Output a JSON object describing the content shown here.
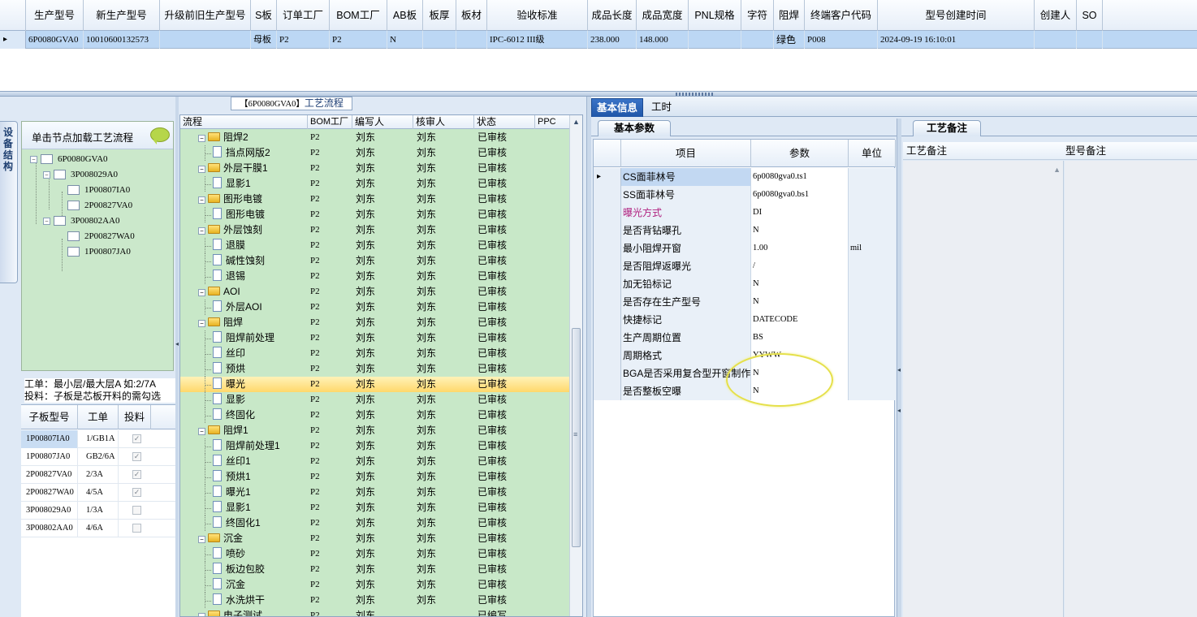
{
  "top_grid": {
    "headers": [
      "生产型号",
      "新生产型号",
      "升级前旧生产型号",
      "S板",
      "订单工厂",
      "BOM工厂",
      "AB板",
      "板厚",
      "板材",
      "验收标准",
      "成品长度",
      "成品宽度",
      "PNL规格",
      "字符",
      "阻焊",
      "终端客户代码",
      "型号创建时间",
      "创建人",
      "SO"
    ],
    "row": [
      "6P0080GVA0",
      "10010600132573",
      "",
      "母板",
      "P2",
      "P2",
      "N",
      "",
      "",
      "IPC-6012 III级",
      "238.000",
      "148.000",
      "",
      "",
      "绿色",
      "P008",
      "2024-09-19 16:10:01",
      "",
      ""
    ]
  },
  "left": {
    "vertical_tab": "设备结构",
    "tree_header": "单击节点加载工艺流程",
    "tree": [
      "6P0080GVA0",
      "3P008029A0",
      "1P00807IA0",
      "2P00827VA0",
      "3P00802AA0",
      "2P00827WA0",
      "1P00807JA0"
    ],
    "info_line1": "工单：最小层/最大层A 如:2/7A",
    "info_line2": "投料：子板是芯板开料的需勾选",
    "sub_headers": [
      "子板型号",
      "工单",
      "投料"
    ],
    "sub_rows": [
      {
        "model": "1P00807IA0",
        "order": "1/GB1A",
        "feed": "checked"
      },
      {
        "model": "1P00807JA0",
        "order": "GB2/6A",
        "feed": "checked"
      },
      {
        "model": "2P00827VA0",
        "order": "2/3A",
        "feed": "checked"
      },
      {
        "model": "2P00827WA0",
        "order": "4/5A",
        "feed": "checked"
      },
      {
        "model": "3P008029A0",
        "order": "1/3A",
        "feed": "unchecked"
      },
      {
        "model": "3P00802AA0",
        "order": "4/6A",
        "feed": "unchecked"
      }
    ]
  },
  "process": {
    "title_prefix": "【6P0080GVA0】",
    "title": "工艺流程",
    "headers": [
      "流程",
      "BOM工厂",
      "编写人",
      "核审人",
      "状态",
      "PPC"
    ],
    "rows": [
      {
        "name": "阻焊2",
        "type": "folder",
        "bom": "P2",
        "writer": "刘东",
        "reviewer": "刘东",
        "status": "已审核"
      },
      {
        "name": "挡点网版2",
        "type": "doc",
        "bom": "P2",
        "writer": "刘东",
        "reviewer": "刘东",
        "status": "已审核"
      },
      {
        "name": "外层干膜1",
        "type": "folder",
        "bom": "P2",
        "writer": "刘东",
        "reviewer": "刘东",
        "status": "已审核"
      },
      {
        "name": "显影1",
        "type": "doc",
        "bom": "P2",
        "writer": "刘东",
        "reviewer": "刘东",
        "status": "已审核"
      },
      {
        "name": "图形电镀",
        "type": "folder",
        "bom": "P2",
        "writer": "刘东",
        "reviewer": "刘东",
        "status": "已审核"
      },
      {
        "name": "图形电镀",
        "type": "doc",
        "bom": "P2",
        "writer": "刘东",
        "reviewer": "刘东",
        "status": "已审核"
      },
      {
        "name": "外层蚀刻",
        "type": "folder",
        "bom": "P2",
        "writer": "刘东",
        "reviewer": "刘东",
        "status": "已审核"
      },
      {
        "name": "退膜",
        "type": "doc",
        "bom": "P2",
        "writer": "刘东",
        "reviewer": "刘东",
        "status": "已审核"
      },
      {
        "name": "碱性蚀刻",
        "type": "doc",
        "bom": "P2",
        "writer": "刘东",
        "reviewer": "刘东",
        "status": "已审核"
      },
      {
        "name": "退锡",
        "type": "doc",
        "bom": "P2",
        "writer": "刘东",
        "reviewer": "刘东",
        "status": "已审核"
      },
      {
        "name": "AOI",
        "type": "folder",
        "bom": "P2",
        "writer": "刘东",
        "reviewer": "刘东",
        "status": "已审核"
      },
      {
        "name": "外层AOI",
        "type": "doc",
        "bom": "P2",
        "writer": "刘东",
        "reviewer": "刘东",
        "status": "已审核"
      },
      {
        "name": "阻焊",
        "type": "folder",
        "bom": "P2",
        "writer": "刘东",
        "reviewer": "刘东",
        "status": "已审核"
      },
      {
        "name": "阻焊前处理",
        "type": "doc",
        "bom": "P2",
        "writer": "刘东",
        "reviewer": "刘东",
        "status": "已审核"
      },
      {
        "name": "丝印",
        "type": "doc",
        "bom": "P2",
        "writer": "刘东",
        "reviewer": "刘东",
        "status": "已审核"
      },
      {
        "name": "预烘",
        "type": "doc",
        "bom": "P2",
        "writer": "刘东",
        "reviewer": "刘东",
        "status": "已审核"
      },
      {
        "name": "曝光",
        "type": "doc",
        "bom": "P2",
        "writer": "刘东",
        "reviewer": "刘东",
        "status": "已审核",
        "selected": true
      },
      {
        "name": "显影",
        "type": "doc",
        "bom": "P2",
        "writer": "刘东",
        "reviewer": "刘东",
        "status": "已审核"
      },
      {
        "name": "终固化",
        "type": "doc",
        "bom": "P2",
        "writer": "刘东",
        "reviewer": "刘东",
        "status": "已审核"
      },
      {
        "name": "阻焊1",
        "type": "folder",
        "bom": "P2",
        "writer": "刘东",
        "reviewer": "刘东",
        "status": "已审核"
      },
      {
        "name": "阻焊前处理1",
        "type": "doc",
        "bom": "P2",
        "writer": "刘东",
        "reviewer": "刘东",
        "status": "已审核"
      },
      {
        "name": "丝印1",
        "type": "doc",
        "bom": "P2",
        "writer": "刘东",
        "reviewer": "刘东",
        "status": "已审核"
      },
      {
        "name": "预烘1",
        "type": "doc",
        "bom": "P2",
        "writer": "刘东",
        "reviewer": "刘东",
        "status": "已审核"
      },
      {
        "name": "曝光1",
        "type": "doc",
        "bom": "P2",
        "writer": "刘东",
        "reviewer": "刘东",
        "status": "已审核"
      },
      {
        "name": "显影1",
        "type": "doc",
        "bom": "P2",
        "writer": "刘东",
        "reviewer": "刘东",
        "status": "已审核"
      },
      {
        "name": "终固化1",
        "type": "doc",
        "bom": "P2",
        "writer": "刘东",
        "reviewer": "刘东",
        "status": "已审核"
      },
      {
        "name": "沉金",
        "type": "folder",
        "bom": "P2",
        "writer": "刘东",
        "reviewer": "刘东",
        "status": "已审核"
      },
      {
        "name": "喷砂",
        "type": "doc",
        "bom": "P2",
        "writer": "刘东",
        "reviewer": "刘东",
        "status": "已审核"
      },
      {
        "name": "板边包胶",
        "type": "doc",
        "bom": "P2",
        "writer": "刘东",
        "reviewer": "刘东",
        "status": "已审核"
      },
      {
        "name": "沉金",
        "type": "doc",
        "bom": "P2",
        "writer": "刘东",
        "reviewer": "刘东",
        "status": "已审核"
      },
      {
        "name": "水洗烘干",
        "type": "doc",
        "bom": "P2",
        "writer": "刘东",
        "reviewer": "刘东",
        "status": "已审核"
      },
      {
        "name": "电子测试",
        "type": "folder",
        "bom": "P2",
        "writer": "刘东",
        "reviewer": "",
        "status": "已编写"
      }
    ]
  },
  "right": {
    "tabs": [
      "基本信息",
      "工时"
    ],
    "subtab_left": "基本参数",
    "subtab_right": "工艺备注",
    "param_headers": [
      "项目",
      "参数",
      "单位"
    ],
    "params": [
      {
        "k": "CS面菲林号",
        "v": "6p0080gva0.ts1",
        "u": ""
      },
      {
        "k": "SS面菲林号",
        "v": "6p0080gva0.bs1",
        "u": ""
      },
      {
        "k": "曝光方式",
        "v": "DI",
        "u": "",
        "magenta": true
      },
      {
        "k": "是否背钻曝孔",
        "v": "N",
        "u": ""
      },
      {
        "k": "最小阻焊开窗",
        "v": "1.00",
        "u": "mil"
      },
      {
        "k": "是否阻焊返曝光",
        "v": "/",
        "u": ""
      },
      {
        "k": "加无铅标记",
        "v": "N",
        "u": ""
      },
      {
        "k": "是否存在生产型号",
        "v": "N",
        "u": ""
      },
      {
        "k": "快捷标记",
        "v": "DATECODE",
        "u": ""
      },
      {
        "k": "生产周期位置",
        "v": "BS",
        "u": ""
      },
      {
        "k": "周期格式",
        "v": "YYWW",
        "u": ""
      },
      {
        "k": "BGA是否采用复合型开窗制作",
        "v": "N",
        "u": ""
      },
      {
        "k": "是否整板空曝",
        "v": "N",
        "u": ""
      }
    ],
    "notes_headers": [
      "工艺备注",
      "型号备注"
    ]
  },
  "colors": {
    "accent": "#1f56a8",
    "row_selected": "#bcd7f4",
    "process_bg": "#c8e8c8",
    "highlight": "#ffd86b"
  }
}
